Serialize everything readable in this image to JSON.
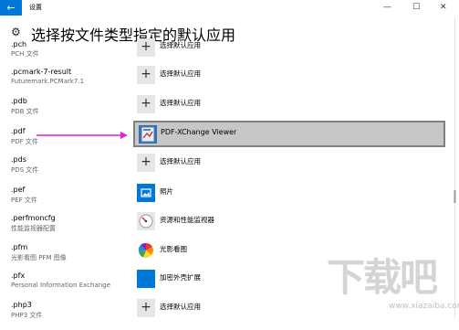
{
  "window": {
    "title": "设置",
    "back_glyph": "←",
    "minimize_glyph": "—",
    "maximize_glyph": "☐",
    "close_glyph": "✕"
  },
  "page": {
    "heading": "选择按文件类型指定的默认应用",
    "gear_glyph": "⚙"
  },
  "rows": [
    {
      "ext": ".pch",
      "desc": "PCH 文件",
      "app": "选择默认应用",
      "icon": "plus-icon"
    },
    {
      "ext": ".pcmark-7-result",
      "desc": "Futuremark.PCMark7.1",
      "app": "选择默认应用",
      "icon": "plus-icon"
    },
    {
      "ext": ".pdb",
      "desc": "PDB 文件",
      "app": "选择默认应用",
      "icon": "plus-icon"
    },
    {
      "ext": ".pdf",
      "desc": "PDF 文件",
      "app": "PDF-XChange Viewer",
      "icon": "pdf-xchange-icon",
      "selected": true
    },
    {
      "ext": ".pds",
      "desc": "PDS 文件",
      "app": "选择默认应用",
      "icon": "plus-icon"
    },
    {
      "ext": ".pef",
      "desc": "PEF 文件",
      "app": "照片",
      "icon": "photos-icon"
    },
    {
      "ext": ".perfmoncfg",
      "desc": "性能监视器配置",
      "app": "资源和性能监视器",
      "icon": "performance-monitor-icon"
    },
    {
      "ext": ".pfm",
      "desc": "光影看图 PFM 图像",
      "app": "光影看图",
      "icon": "photo-viewer-icon"
    },
    {
      "ext": ".pfx",
      "desc": "Personal Information Exchange",
      "app": "加密外壳扩展",
      "icon": "crypto-shell-icon"
    },
    {
      "ext": ".php3",
      "desc": "PHP3 文件",
      "app": "选择默认应用",
      "icon": "plus-icon"
    }
  ],
  "plus_glyph": "+",
  "watermark": {
    "text": "下载吧",
    "url": "www.xiazaiba.com"
  },
  "colors": {
    "accent": "#0078d7",
    "highlight_arrow": "#e020e0",
    "selected_bg": "#c7c7c7"
  }
}
